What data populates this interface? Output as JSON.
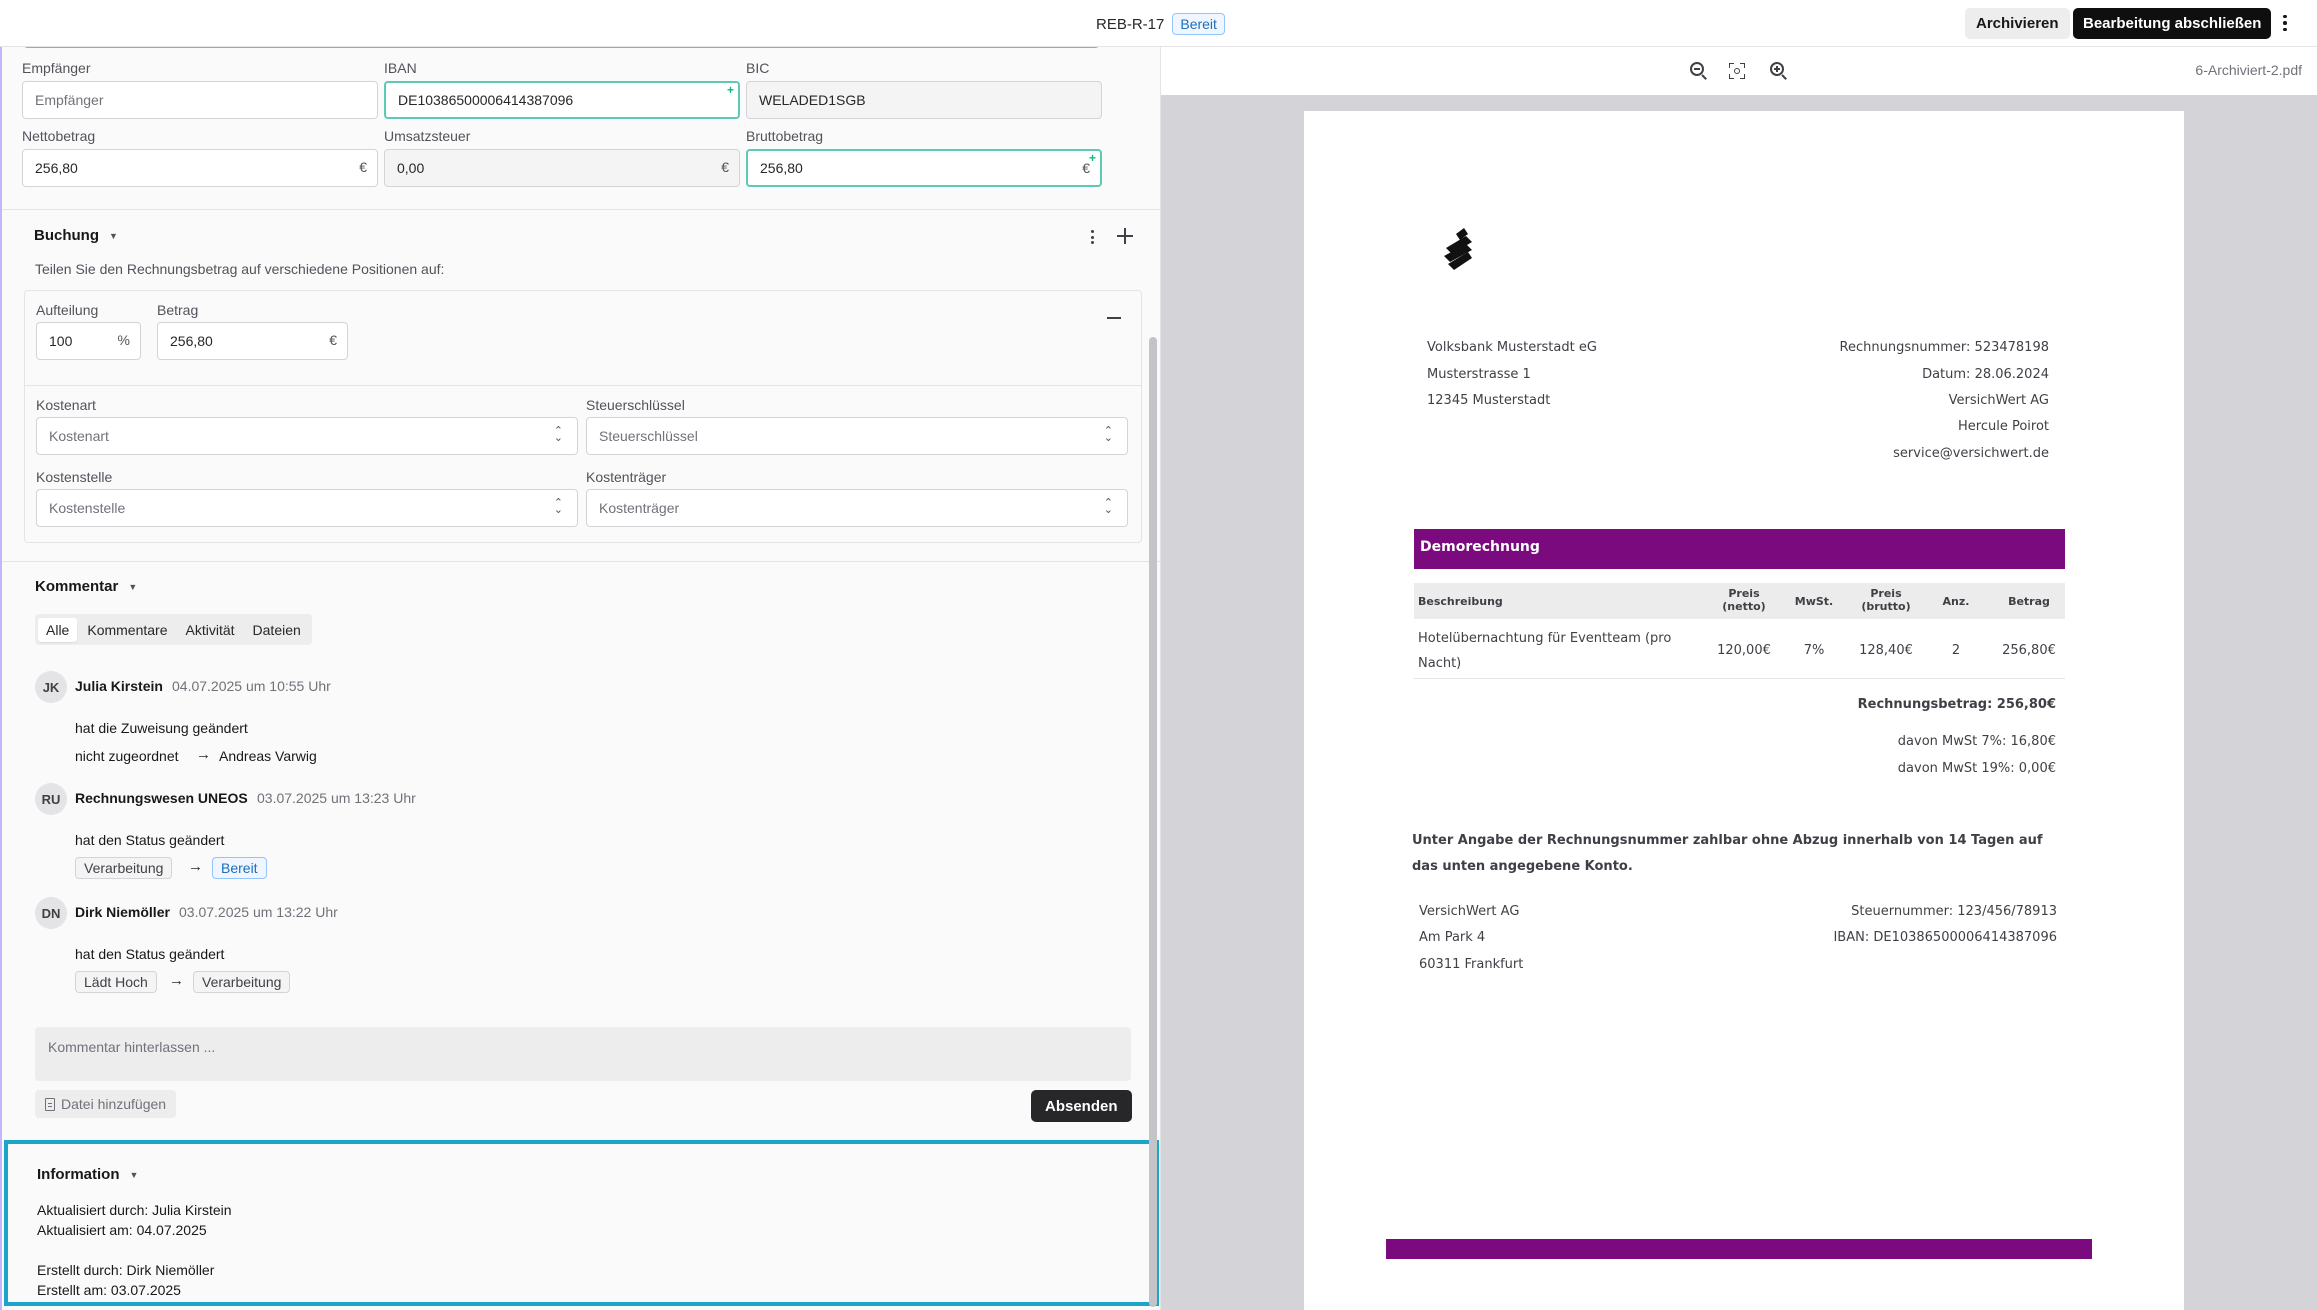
{
  "header": {
    "doc_id": "REB-R-17",
    "status": "Bereit",
    "archive_label": "Archivieren",
    "finish_label": "Bearbeitung abschließen"
  },
  "fields": {
    "recipient_label": "Empfänger",
    "recipient_placeholder": "Empfänger",
    "iban_label": "IBAN",
    "iban_value": "DE10386500006414387096",
    "bic_label": "BIC",
    "bic_value": "WELADED1SGB",
    "net_label": "Nettobetrag",
    "net_value": "256,80",
    "vat_label": "Umsatzsteuer",
    "vat_value": "0,00",
    "gross_label": "Bruttobetrag",
    "gross_value": "256,80",
    "currency": "€"
  },
  "booking": {
    "title": "Buchung",
    "hint": "Teilen Sie den Rechnungsbetrag auf verschiedene Positionen auf:",
    "split_label": "Aufteilung",
    "split_value": "100",
    "split_unit": "%",
    "amount_label": "Betrag",
    "amount_value": "256,80",
    "cost_type_label": "Kostenart",
    "cost_type_placeholder": "Kostenart",
    "tax_key_label": "Steuerschlüssel",
    "tax_key_placeholder": "Steuerschlüssel",
    "cost_center_label": "Kostenstelle",
    "cost_center_placeholder": "Kostenstelle",
    "cost_unit_label": "Kostenträger",
    "cost_unit_placeholder": "Kostenträger"
  },
  "comments": {
    "title": "Kommentar",
    "tabs": [
      "Alle",
      "Kommentare",
      "Aktivität",
      "Dateien"
    ],
    "activities": [
      {
        "initials": "JK",
        "name": "Julia Kirstein",
        "time": "04.07.2025 um 10:55 Uhr",
        "text": "hat die Zuweisung geändert",
        "from": "nicht zugeordnet",
        "to": "Andreas Varwig"
      },
      {
        "initials": "RU",
        "name": "Rechnungswesen UNEOS",
        "time": "03.07.2025 um 13:23 Uhr",
        "text": "hat den Status geändert",
        "from": "Verarbeitung",
        "to": "Bereit"
      },
      {
        "initials": "DN",
        "name": "Dirk Niemöller",
        "time": "03.07.2025 um 13:22 Uhr",
        "text": "hat den Status geändert",
        "from": "Lädt Hoch",
        "to": "Verarbeitung"
      }
    ],
    "placeholder": "Kommentar hinterlassen ...",
    "add_file_label": "Datei hinzufügen",
    "send_label": "Absenden"
  },
  "information": {
    "title": "Information",
    "updated_by": "Aktualisiert durch: Julia Kirstein",
    "updated_at": "Aktualisiert am: 04.07.2025",
    "created_by": "Erstellt durch: Dirk Niemöller",
    "created_at": "Erstellt am: 03.07.2025"
  },
  "viewer": {
    "filename": "6-Archiviert-2.pdf"
  },
  "pdf": {
    "sender": [
      "Volksbank Musterstadt eG",
      "Musterstrasse 1",
      "12345 Musterstadt"
    ],
    "meta": [
      "Rechnungsnummer: 523478198",
      "Datum: 28.06.2024",
      "VersichWert AG",
      "Hercule Poirot",
      "service@versichwert.de"
    ],
    "banner": "Demorechnung",
    "table_headers": [
      "Beschreibung",
      "Preis\n(netto)",
      "MwSt.",
      "Preis\n(brutto)",
      "Anz.",
      "Betrag"
    ],
    "row": {
      "desc1": "Hotelübernachtung für Eventteam (pro",
      "desc2": "Nacht)",
      "net": "120,00€",
      "vat": "7%",
      "gross": "128,40€",
      "qty": "2",
      "amount": "256,80€"
    },
    "total": "Rechnungsbetrag: 256,80€",
    "vat7": "davon MwSt 7%: 16,80€",
    "vat19": "davon MwSt 19%: 0,00€",
    "terms1": "Unter Angabe der Rechnungsnummer zahlbar ohne Abzug innerhalb von 14 Tagen auf",
    "terms2": "das unten angegebene Konto.",
    "footer_left": [
      "VersichWert AG",
      "Am Park 4",
      "60311 Frankfurt"
    ],
    "footer_right": [
      "Steuernummer: 123/456/78913",
      "IBAN: DE10386500006414387096"
    ]
  },
  "colors": {
    "accent_green": "#5ec9b5",
    "status_blue": "#1d6fb8",
    "info_highlight": "#1ba6c9",
    "pdf_purple": "#7b0a7e"
  }
}
